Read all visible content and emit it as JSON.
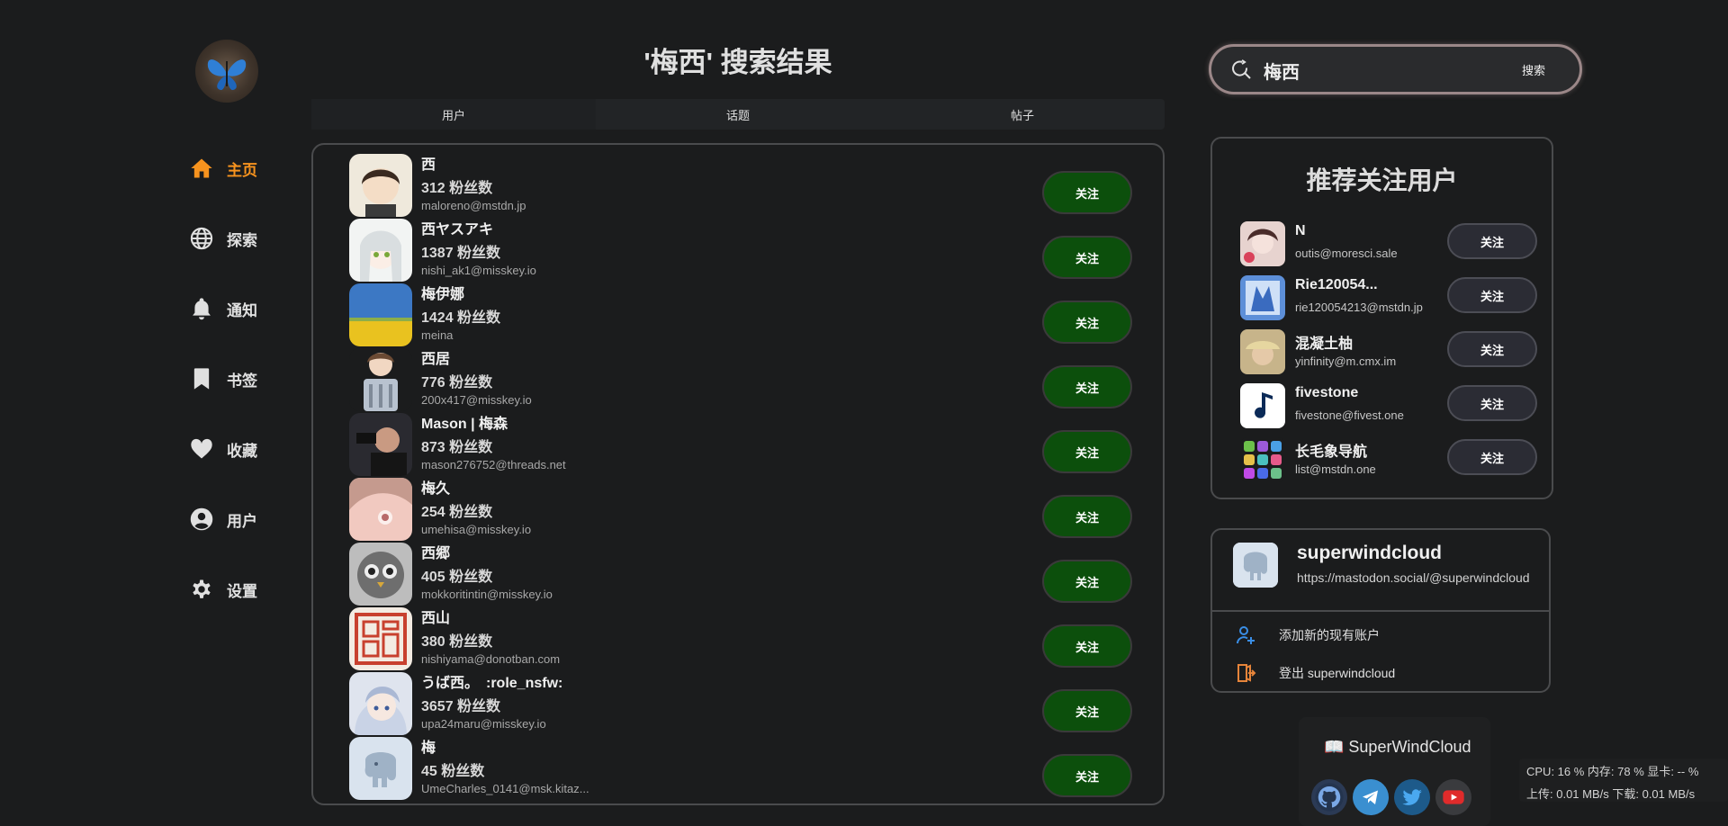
{
  "page": {
    "title": "'梅西' 搜索结果"
  },
  "sidebar": {
    "items": [
      {
        "label": "主页",
        "icon": "home-icon",
        "active": true
      },
      {
        "label": "探索",
        "icon": "globe-icon"
      },
      {
        "label": "通知",
        "icon": "bell-icon"
      },
      {
        "label": "书签",
        "icon": "bookmark-icon"
      },
      {
        "label": "收藏",
        "icon": "heart-icon"
      },
      {
        "label": "用户",
        "icon": "user-icon"
      },
      {
        "label": "设置",
        "icon": "gear-icon"
      }
    ]
  },
  "tabs": [
    {
      "label": "用户",
      "active": true
    },
    {
      "label": "话题"
    },
    {
      "label": "帖子"
    }
  ],
  "results": [
    {
      "name": "西",
      "fans": "312 粉丝数",
      "acct": "maloreno@mstdn.jp",
      "follow": "关注"
    },
    {
      "name": "西ヤスアキ",
      "fans": "1387 粉丝数",
      "acct": "nishi_ak1@misskey.io",
      "follow": "关注"
    },
    {
      "name": "梅伊娜",
      "fans": "1424 粉丝数",
      "acct": "meina",
      "follow": "关注"
    },
    {
      "name": "西居",
      "fans": "776 粉丝数",
      "acct": "200x417@misskey.io",
      "follow": "关注"
    },
    {
      "name": "Mason | 梅森",
      "fans": "873 粉丝数",
      "acct": "mason276752@threads.net",
      "follow": "关注"
    },
    {
      "name": "梅久",
      "fans": "254 粉丝数",
      "acct": "umehisa@misskey.io",
      "follow": "关注"
    },
    {
      "name": "西郷",
      "fans": "405 粉丝数",
      "acct": "mokkoritintin@misskey.io",
      "follow": "关注"
    },
    {
      "name": "西山",
      "fans": "380 粉丝数",
      "acct": "nishiyama@donotban.com",
      "follow": "关注"
    },
    {
      "name": "うば西。　:role_nsfw:",
      "fans": "3657 粉丝数",
      "acct": "upa24maru@misskey.io",
      "follow": "关注"
    },
    {
      "name": "梅",
      "fans": "45 粉丝数",
      "acct": "UmeCharles_0141@msk.kitaz...",
      "follow": "关注"
    }
  ],
  "search": {
    "value": "梅西",
    "button": "搜索"
  },
  "recommend": {
    "title": "推荐关注用户",
    "items": [
      {
        "name": "N",
        "acct": "outis@moresci.sale",
        "follow": "关注"
      },
      {
        "name": "Rie120054...",
        "acct": "rie120054213@mstdn.jp",
        "follow": "关注"
      },
      {
        "name": "混凝土柚",
        "acct": "yinfinity@m.cmx.im",
        "follow": "关注"
      },
      {
        "name": "fivestone",
        "acct": "fivestone@fivest.one",
        "follow": "关注"
      },
      {
        "name": "长毛象导航",
        "acct": "list@mstdn.one",
        "follow": "关注"
      }
    ]
  },
  "account": {
    "name": "superwindcloud",
    "url": "https://mastodon.social/@superwindcloud",
    "add_account": "添加新的现有账户",
    "logout": "登出 superwindcloud"
  },
  "footer": {
    "brand": "📖 SuperWindCloud",
    "social": [
      "github-icon",
      "telegram-icon",
      "twitter-icon",
      "youtube-icon"
    ]
  },
  "monitor": {
    "line1": "CPU: 16 %  内存: 78 %  显卡: -- %",
    "line2": "上传: 0.01 MB/s  下载: 0.01 MB/s"
  },
  "colors": {
    "accent": "#f7931e",
    "follow_green": "#0c4f0c",
    "background": "#1b1c1d"
  }
}
